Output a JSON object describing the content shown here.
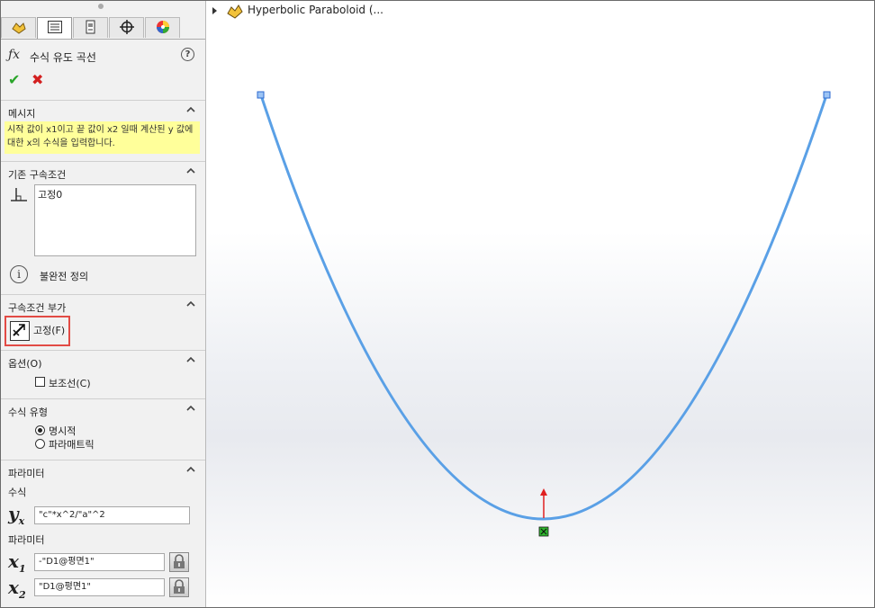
{
  "panel": {
    "tabs": [
      "feature-manager",
      "property-manager",
      "configuration-manager",
      "dimxpert-manager",
      "display-manager"
    ],
    "title": "수식 유도 곡선",
    "help_label": "?",
    "ok_label": "✔",
    "cancel_label": "✖",
    "message": {
      "header": "메시지",
      "text": "시작 값이 x1이고 끝 값이 x2 일때 계산된 y 값에 대한 x의 수식을 입력합니다."
    },
    "existing_relations": {
      "header": "기존 구속조건",
      "items": [
        "고정0"
      ],
      "status": "불완전 정의"
    },
    "add_relations": {
      "header": "구속조건 부가",
      "fix_label": "고정(F)"
    },
    "options": {
      "header": "옵션(O)",
      "construction_label": "보조선(C)",
      "construction_checked": false
    },
    "equation_type": {
      "header": "수식 유형",
      "explicit_label": "명시적",
      "parametric_label": "파라매트릭",
      "selected": "explicit"
    },
    "parameters": {
      "header": "파라미터",
      "equation_label": "수식",
      "yx_value": "\"c\"*x^2/\"a\"^2",
      "params_label": "파라미터",
      "x1_value": "-\"D1@평면1\"",
      "x2_value": "\"D1@평면1\""
    }
  },
  "viewport": {
    "tree_label": "Hyperbolic Paraboloid (...",
    "curve_color": "#5aa0e6",
    "point_color": "#2d6ad0",
    "origin_arrow_color": "#e02020",
    "fix_marker_color": "#2db52d"
  }
}
